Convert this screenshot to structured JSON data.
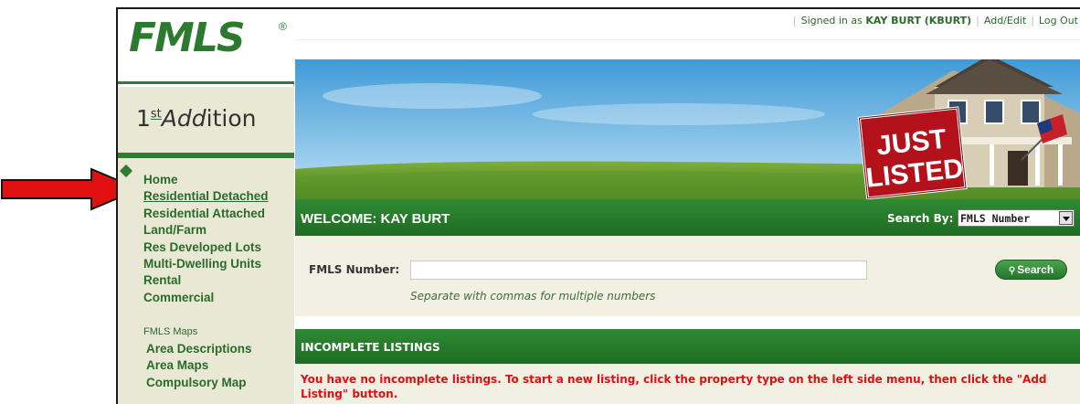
{
  "brand": {
    "logo": "FMLS",
    "reg_mark": "®",
    "product": {
      "prefix": "1",
      "superscript": "st",
      "italic": "Add",
      "suffix": "ition"
    }
  },
  "topbar": {
    "signed_in_prefix": "Signed in as ",
    "user": "KAY BURT (KBURT)",
    "add_edit": "Add/Edit",
    "log_out": "Log Out"
  },
  "banner": {
    "sign_line1": "JUST",
    "sign_line2": "LISTED"
  },
  "sidebar": {
    "items": [
      {
        "label": "Home"
      },
      {
        "label": "Residential Detached"
      },
      {
        "label": "Residential Attached"
      },
      {
        "label": "Land/Farm"
      },
      {
        "label": "Res Developed Lots"
      },
      {
        "label": "Multi-Dwelling Units"
      },
      {
        "label": "Rental"
      },
      {
        "label": "Commercial"
      }
    ],
    "maps_title": "FMLS Maps",
    "maps_items": [
      {
        "label": "Area Descriptions"
      },
      {
        "label": "Area Maps"
      },
      {
        "label": "Compulsory Map"
      }
    ]
  },
  "welcome": {
    "title": "WELCOME: KAY BURT",
    "search_by_label": "Search By:",
    "search_by_value": "FMLS Number"
  },
  "search": {
    "label": "FMLS Number:",
    "value": "",
    "hint": "Separate with commas for multiple numbers",
    "button": "Search"
  },
  "incomplete": {
    "title": "INCOMPLETE LISTINGS",
    "message": "You have no incomplete listings. To start a new listing, click the property type on the left side menu, then click the \"Add Listing\" button."
  },
  "colors": {
    "brand_green": "#2e7d32",
    "header_green": "#1f6b24",
    "nav_bg": "#e9e8d4",
    "alert_red": "#dd1111",
    "annotation_arrow": "#e01010"
  },
  "icons": {
    "search_button": "magnifier-icon",
    "nav_bullet": "diamond-icon",
    "dropdown": "chevron-down-icon",
    "annotation": "red-arrow-icon"
  }
}
